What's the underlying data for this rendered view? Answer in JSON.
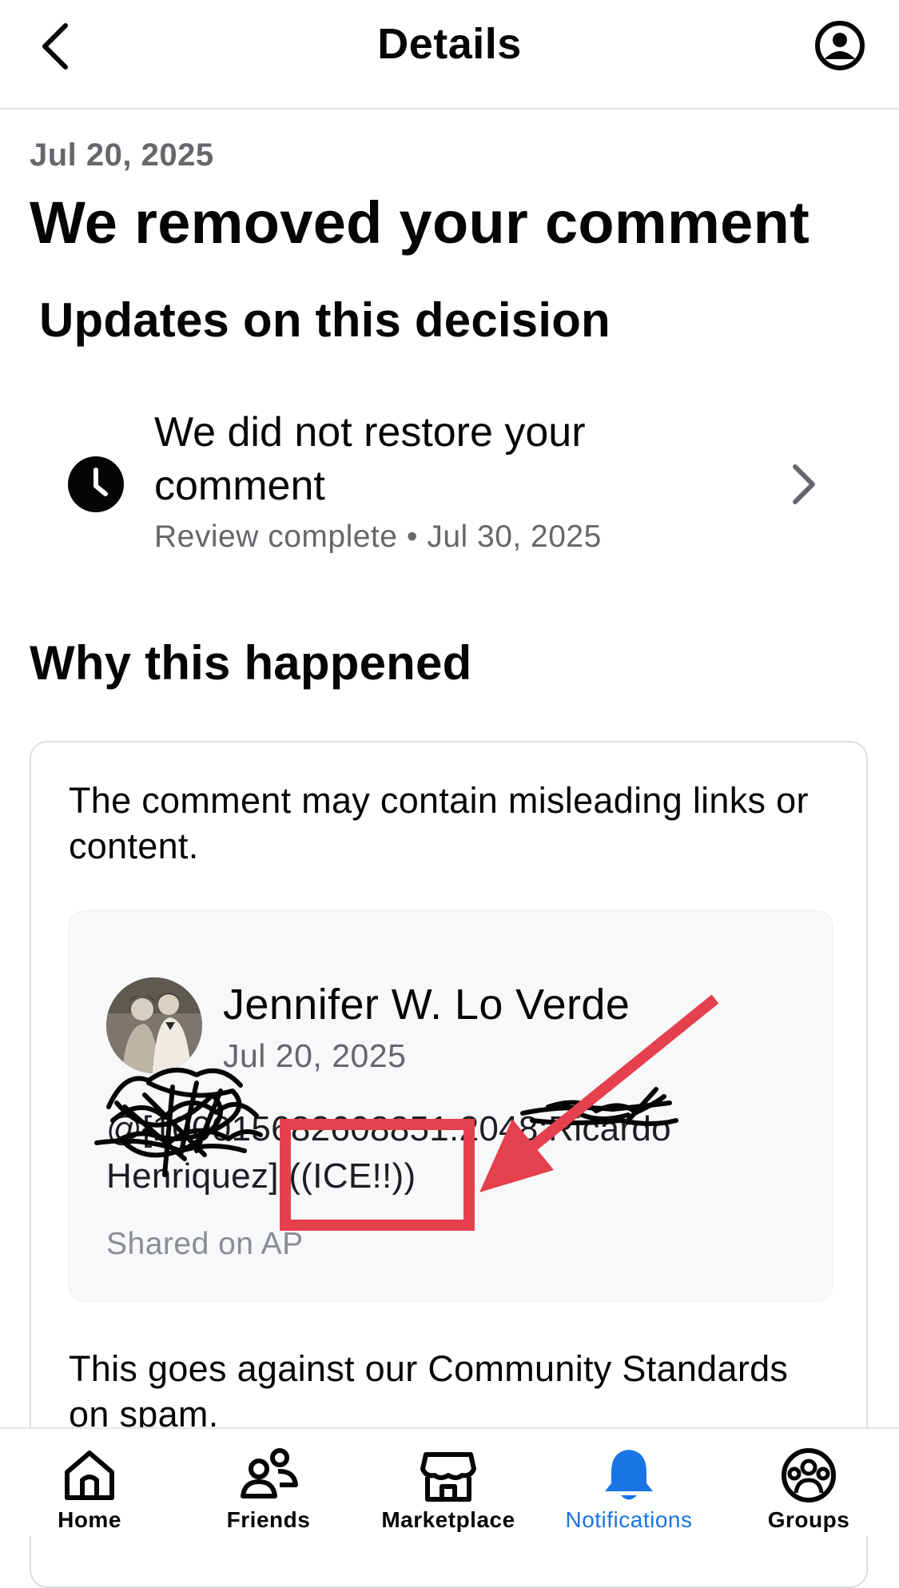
{
  "header": {
    "title": "Details",
    "back_icon": "chevron-left-icon",
    "profile_icon": "user-circle-icon"
  },
  "notice": {
    "date": "Jul 20, 2025",
    "title": "We removed your comment"
  },
  "updates": {
    "heading": "Updates on this decision",
    "item": {
      "icon": "clock-icon",
      "title": "We did not restore your comment",
      "status": "Review complete",
      "separator": "•",
      "date": "Jul 30, 2025"
    }
  },
  "why": {
    "heading": "Why this happened",
    "reason": "The comment may contain misleading links or content.",
    "comment": {
      "author": "Jennifer W. Lo Verde",
      "date": "Jul 20, 2025",
      "body_line1": "@[100015682608851:2048:Ricardo",
      "body_line2_prefix": "Henriquez]",
      "body_highlight": "((ICE!!))",
      "shared_on": "Shared on AP"
    },
    "standards": "This goes against our Community Standards on spam."
  },
  "annotation": {
    "highlight_color": "#e5404d"
  },
  "tabbar": {
    "active_color": "#1b74e4",
    "tabs": [
      {
        "label": "Home",
        "icon": "home-icon"
      },
      {
        "label": "Friends",
        "icon": "friends-icon"
      },
      {
        "label": "Marketplace",
        "icon": "marketplace-icon"
      },
      {
        "label": "Notifications",
        "icon": "bell-icon",
        "active": true
      },
      {
        "label": "Groups",
        "icon": "groups-icon"
      }
    ]
  }
}
